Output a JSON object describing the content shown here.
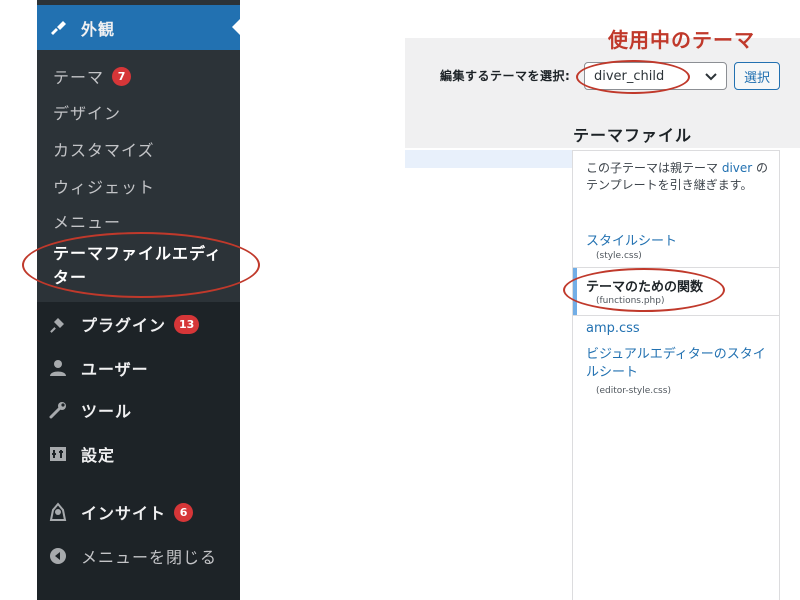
{
  "sidebar": {
    "appearance": {
      "label": "外観",
      "icon": "paintbrush-icon"
    },
    "submenu": [
      {
        "label": "テーマ",
        "badge": "7"
      },
      {
        "label": "デザイン"
      },
      {
        "label": "カスタマイズ"
      },
      {
        "label": "ウィジェット"
      },
      {
        "label": "メニュー"
      },
      {
        "label_line1": "テーマファイルエディ",
        "label_line2": "ター",
        "current": true
      }
    ],
    "plugins": {
      "label": "プラグイン",
      "badge": "13",
      "icon": "plugin-icon"
    },
    "users": {
      "label": "ユーザー",
      "icon": "user-icon"
    },
    "tools": {
      "label": "ツール",
      "icon": "wrench-icon"
    },
    "settings": {
      "label": "設定",
      "icon": "settings-icon"
    },
    "insight": {
      "label": "インサイト",
      "badge": "6",
      "icon": "insight-icon"
    },
    "collapse": {
      "label": "メニューを閉じる",
      "icon": "collapse-icon"
    }
  },
  "editor": {
    "select_label": "編集するテーマを選択:",
    "selected_theme": "diver_child",
    "select_button": "選択",
    "files_heading": "テーマファイル",
    "parent_note_pre": "この子テーマは親テーマ ",
    "parent_note_link": "diver",
    "parent_note_post": " のテンプレートを引き継ぎます。",
    "files": [
      {
        "label": "スタイルシート",
        "sub": "(style.css)"
      },
      {
        "label": "テーマのための関数",
        "sub": "(functions.php)",
        "current": true
      },
      {
        "label": "amp.css"
      },
      {
        "label": "ビジュアルエディターのスタイルシート",
        "sub": "(editor-style.css)"
      }
    ]
  },
  "annotation": {
    "text": "使用中のテーマ",
    "color": "#c0392b"
  },
  "colors": {
    "sidebar_bg": "#1d2327",
    "active_blue": "#2271b1",
    "badge_red": "#d63638",
    "link_blue": "#2271b1"
  }
}
